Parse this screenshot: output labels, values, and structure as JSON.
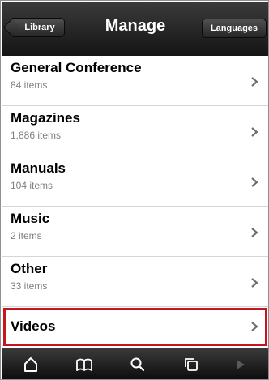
{
  "navbar": {
    "title": "Manage",
    "back_label": "Library",
    "right_label": "Languages"
  },
  "list": [
    {
      "title": "General Conference",
      "subtitle": "84 items"
    },
    {
      "title": "Magazines",
      "subtitle": "1,886 items"
    },
    {
      "title": "Manuals",
      "subtitle": "104 items"
    },
    {
      "title": "Music",
      "subtitle": "2 items"
    },
    {
      "title": "Other",
      "subtitle": "33 items"
    },
    {
      "title": "Videos",
      "subtitle": ""
    }
  ],
  "highlight_color": "#c4161c",
  "tabbar": {
    "icons": [
      "home-icon",
      "book-icon",
      "search-icon",
      "copy-icon",
      "play-icon"
    ]
  }
}
